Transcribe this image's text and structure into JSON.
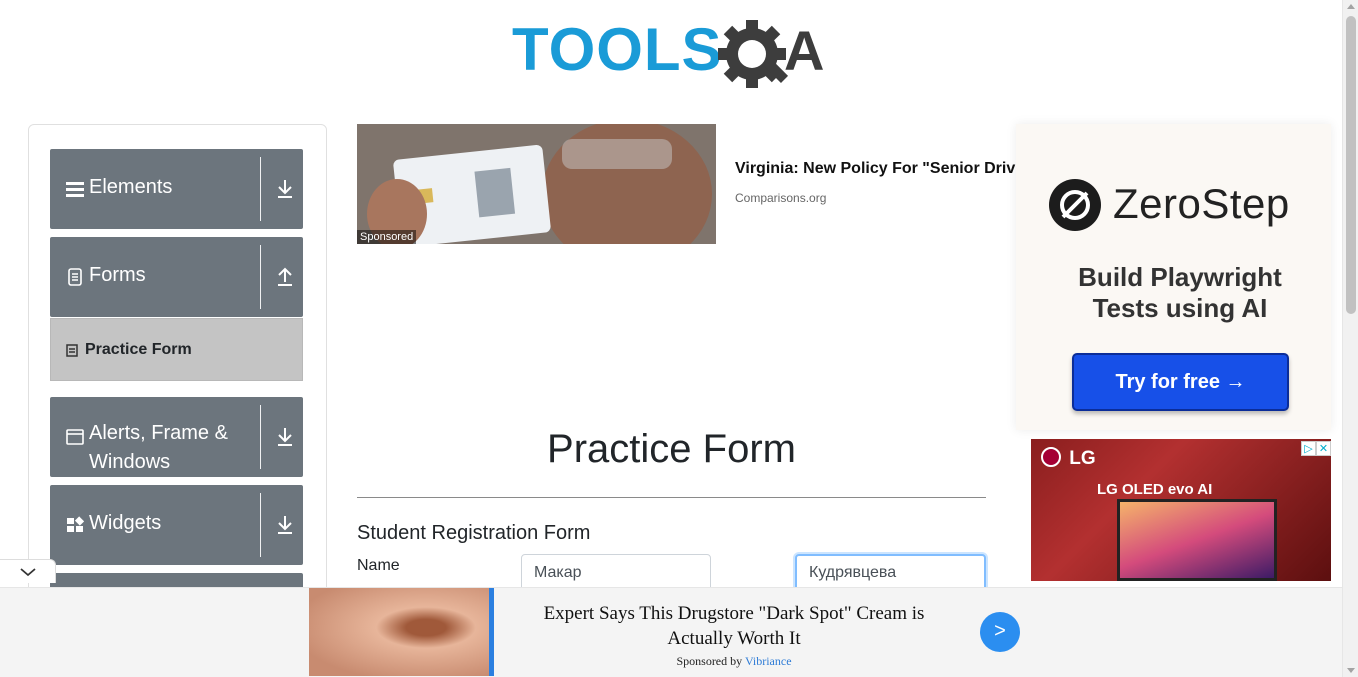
{
  "logo": {
    "text": "TOOLSQA"
  },
  "sidebar": {
    "groups": [
      {
        "label": "Elements",
        "icon": "hamburger-icon",
        "expanded": false
      },
      {
        "label": "Forms",
        "icon": "document-icon",
        "expanded": true
      },
      {
        "label": "Alerts, Frame & Windows",
        "icon": "window-icon",
        "expanded": false
      },
      {
        "label": "Widgets",
        "icon": "widgets-icon",
        "expanded": false
      }
    ],
    "active_item": "Practice Form"
  },
  "ad_top": {
    "sponsored": "Sponsored",
    "title": "Virginia: New Policy For \"Senior Driv",
    "source": "Comparisons.org"
  },
  "main": {
    "title": "Practice Form",
    "subtitle": "Student Registration Form",
    "name_label": "Name",
    "first_name_value": "Макар",
    "last_name_value": "Кудрявцева"
  },
  "ad_zerostep": {
    "brand": "ZeroStep",
    "tagline": "Build Playwright Tests using AI",
    "cta": "Try for free →"
  },
  "ad_lg": {
    "brand": "LG",
    "product": "LG OLED evo AI"
  },
  "ad_bottom": {
    "title": "Expert Says This Drugstore \"Dark Spot\" Cream is Actually Worth It",
    "sponsored_by": "Sponsored by",
    "sponsor": "Vibriance",
    "go": ">"
  },
  "colors": {
    "sidebar_group": "#6c757d",
    "active_item": "#c4c4c4",
    "logo_blue": "#1a9bd7",
    "logo_gray": "#3d3d3d",
    "focus_border": "#80bdff"
  }
}
